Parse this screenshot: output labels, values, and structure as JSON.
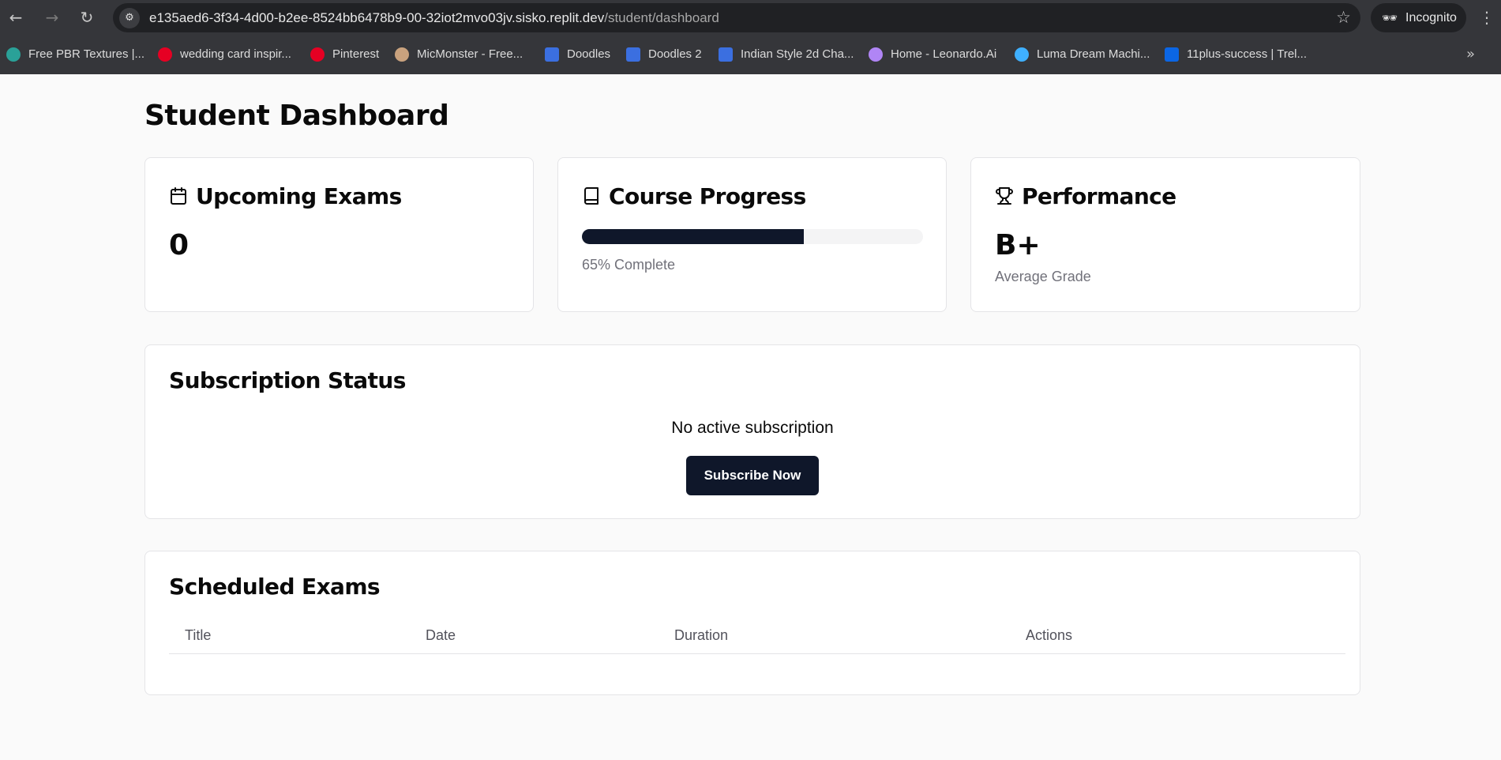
{
  "browser": {
    "url_host": "e135aed6-3f34-4d00-b2ee-8524bb6478b9-00-32iot2mvo03jv.sisko.replit.dev",
    "url_path": "/student/dashboard",
    "incognito_label": "Incognito",
    "bookmarks": [
      {
        "label": "Free PBR Textures |...",
        "icon": "globe-icon",
        "color": "#2aa198"
      },
      {
        "label": "wedding card inspir...",
        "icon": "pinterest-icon",
        "color": "#e60023"
      },
      {
        "label": "Pinterest",
        "icon": "pinterest-icon",
        "color": "#e60023"
      },
      {
        "label": "MicMonster - Free...",
        "icon": "micmonster-icon",
        "color": "#c9a27e"
      },
      {
        "label": "Doodles",
        "icon": "forms-icon",
        "color": "#3b6fe0"
      },
      {
        "label": "Doodles 2",
        "icon": "forms-icon",
        "color": "#3b6fe0"
      },
      {
        "label": "Indian Style 2d Cha...",
        "icon": "forms-icon",
        "color": "#3b6fe0"
      },
      {
        "label": "Home - Leonardo.Ai",
        "icon": "leonardo-icon",
        "color": "#b085f5"
      },
      {
        "label": "Luma Dream Machi...",
        "icon": "luma-icon",
        "color": "#3fb0ff"
      },
      {
        "label": "11plus-success | Trel...",
        "icon": "trello-icon",
        "color": "#0b66e4"
      }
    ]
  },
  "page": {
    "title": "Student Dashboard"
  },
  "cards": {
    "upcoming_exams": {
      "title": "Upcoming Exams",
      "icon": "calendar-icon",
      "value": "0"
    },
    "course_progress": {
      "title": "Course Progress",
      "icon": "book-icon",
      "progress": 0.65,
      "label": "65% Complete"
    },
    "performance": {
      "title": "Performance",
      "icon": "trophy-icon",
      "value": "B+",
      "label": "Average Grade"
    }
  },
  "subscription": {
    "title": "Subscription Status",
    "message": "No active subscription",
    "button_label": "Subscribe Now"
  },
  "scheduled_exams": {
    "title": "Scheduled Exams",
    "columns": [
      "Title",
      "Date",
      "Duration",
      "Actions"
    ],
    "rows": []
  },
  "colors": {
    "primary": "#0f172a",
    "background": "#fafafa",
    "card_border": "#e4e4e7",
    "muted_text": "#71717a"
  }
}
